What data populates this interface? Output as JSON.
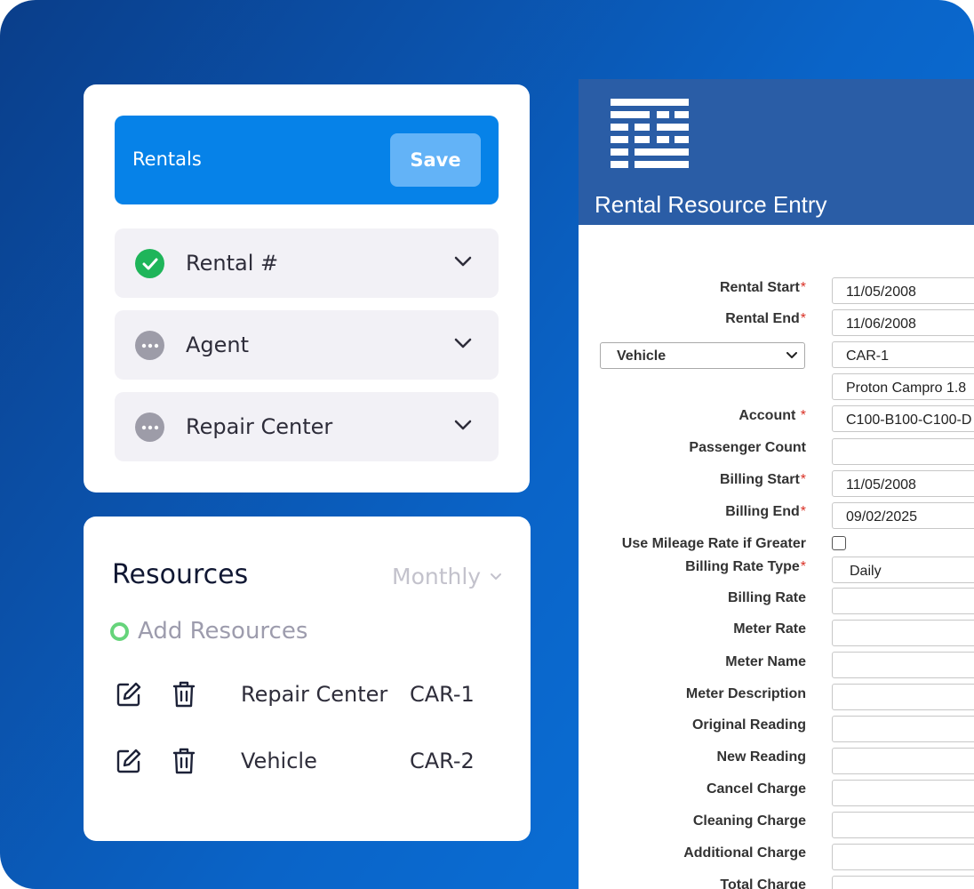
{
  "rentals_card": {
    "header_title": "Rentals",
    "save_label": "Save",
    "items": [
      {
        "label": "Rental #",
        "status": "complete"
      },
      {
        "label": "Agent",
        "status": "pending"
      },
      {
        "label": "Repair Center",
        "status": "pending"
      }
    ]
  },
  "resources_card": {
    "title": "Resources",
    "period": "Monthly",
    "add_label": "Add Resources",
    "rows": [
      {
        "name": "Repair Center",
        "code": "CAR-1"
      },
      {
        "name": "Vehicle",
        "code": "CAR-2"
      }
    ]
  },
  "form": {
    "title": "Rental Resource Entry",
    "resource_type": "Vehicle",
    "fields": {
      "rental_start": {
        "label": "Rental Start",
        "value": "11/05/2008"
      },
      "rental_end": {
        "label": "Rental End",
        "value": "11/06/2008"
      },
      "resource_code": {
        "value": "CAR-1"
      },
      "resource_desc": {
        "value": "Proton Campro 1.8"
      },
      "account": {
        "label": "Account",
        "value": "C100-B100-C100-D"
      },
      "passenger_count": {
        "label": "Passenger Count",
        "value": ""
      },
      "billing_start": {
        "label": "Billing Start",
        "value": "11/05/2008"
      },
      "billing_end": {
        "label": "Billing End",
        "value": "09/02/2025"
      },
      "use_mileage": {
        "label": "Use Mileage Rate if Greater",
        "checked": false
      },
      "billing_rate_type": {
        "label": "Billing Rate Type",
        "value": "Daily"
      },
      "billing_rate": {
        "label": "Billing Rate",
        "value": ""
      },
      "meter_rate": {
        "label": "Meter Rate",
        "value": ""
      },
      "meter_name": {
        "label": "Meter Name",
        "value": ""
      },
      "meter_description": {
        "label": "Meter Description",
        "value": ""
      },
      "original_reading": {
        "label": "Original Reading",
        "value": ""
      },
      "new_reading": {
        "label": "New Reading",
        "value": ""
      },
      "cancel_charge": {
        "label": "Cancel Charge",
        "value": ""
      },
      "cleaning_charge": {
        "label": "Cleaning Charge",
        "value": ""
      },
      "additional_charge": {
        "label": "Additional Charge",
        "value": ""
      },
      "total_charge": {
        "label": "Total Charge",
        "value": ""
      }
    },
    "required_marker": "*"
  },
  "colors": {
    "primary": "#0682e8",
    "success": "#1fb55a",
    "form_header": "#2a5da6",
    "required": "#d93025"
  }
}
